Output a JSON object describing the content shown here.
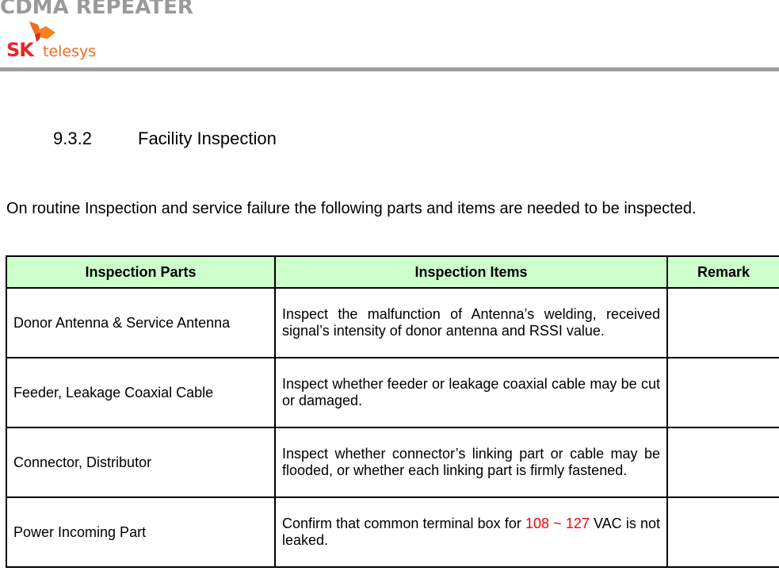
{
  "header": {
    "doc_title": "CDMA REPEATER",
    "logo": {
      "brand": "SK",
      "name": "telesys",
      "icon": "sk-butterfly-logo-icon",
      "colors": {
        "brand": "#e8262b",
        "name": "#f26a21"
      }
    },
    "bar_color": "#9e9e9e"
  },
  "section": {
    "number": "9.3.2",
    "title": "Facility Inspection",
    "intro": "On routine Inspection and service failure the following parts and items are needed to be inspected."
  },
  "table": {
    "header_bg": "#ccffcc",
    "columns": [
      "Inspection Parts",
      "Inspection Items",
      "Remark"
    ],
    "rows": [
      {
        "part": "Donor Antenna & Service Antenna",
        "item": "Inspect the malfunction of Antenna’s welding, received signal’s intensity of donor antenna and RSSI value.",
        "remark": ""
      },
      {
        "part": "Feeder, Leakage Coaxial Cable",
        "item": "Inspect whether feeder or leakage coaxial cable may be cut or damaged.",
        "remark": ""
      },
      {
        "part": "Connector, Distributor",
        "item": "Inspect whether connector’s linking part or cable may be flooded, or whether each linking part is firmly fastened.",
        "remark": ""
      },
      {
        "part": "Power Incoming Part",
        "item_prefix": "Confirm that common terminal box for ",
        "item_highlight": "108 ~ 127",
        "item_suffix": " VAC is not leaked.",
        "highlight_color": "#ff0000",
        "remark": ""
      }
    ]
  }
}
